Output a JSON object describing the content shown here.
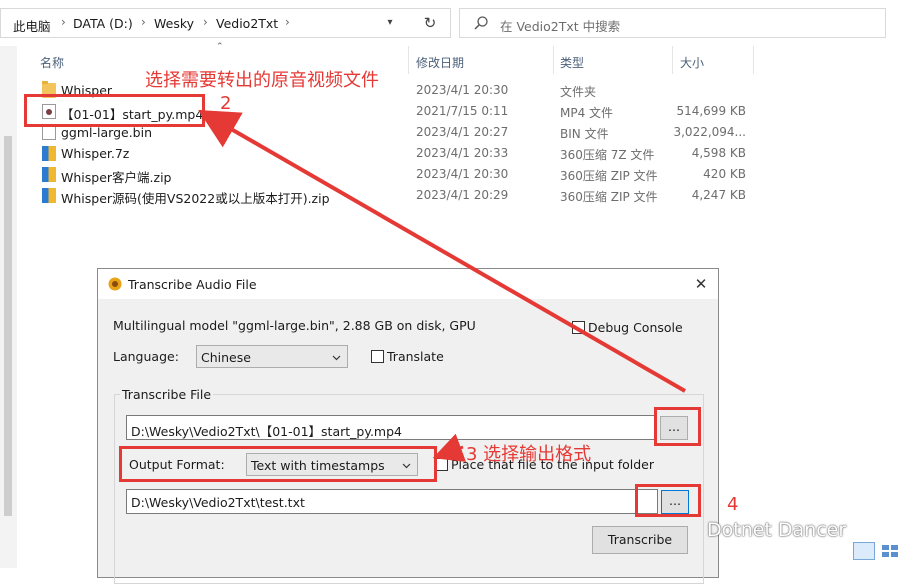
{
  "breadcrumb": [
    "此电脑",
    "DATA (D:)",
    "Wesky",
    "Vedio2Txt"
  ],
  "search": {
    "placeholder": "在 Vedio2Txt 中搜索"
  },
  "columns": {
    "name": "名称",
    "date": "修改日期",
    "type": "类型",
    "size": "大小"
  },
  "files": [
    {
      "name": "Whisper",
      "date": "2023/4/1 20:30",
      "type": "文件夹",
      "size": "",
      "icon": "folder-icon"
    },
    {
      "name": "【01-01】start_py.mp4",
      "date": "2021/7/15 0:11",
      "type": "MP4 文件",
      "size": "514,699 KB",
      "icon": "video-file-icon"
    },
    {
      "name": "ggml-large.bin",
      "date": "2023/4/1 20:27",
      "type": "BIN 文件",
      "size": "3,022,094...",
      "icon": "file-icon"
    },
    {
      "name": "Whisper.7z",
      "date": "2023/4/1 20:33",
      "type": "360压缩 7Z 文件",
      "size": "4,598 KB",
      "icon": "archive-icon"
    },
    {
      "name": "Whisper客户端.zip",
      "date": "2023/4/1 20:30",
      "type": "360压缩 ZIP 文件",
      "size": "420 KB",
      "icon": "archive-icon"
    },
    {
      "name": "Whisper源码(使用VS2022或以上版本打开).zip",
      "date": "2023/4/1 20:29",
      "type": "360压缩 ZIP 文件",
      "size": "4,247 KB",
      "icon": "archive-icon"
    }
  ],
  "annotations": {
    "step1": "选择需要转出的原音视频文件",
    "step2": "2",
    "step3": "3 选择输出格式",
    "step4": "4"
  },
  "dialog": {
    "title": "Transcribe Audio File",
    "model_info": "Multilingual model \"ggml-large.bin\", 2.88 GB on disk, GPU",
    "debug_console": "Debug Console",
    "language_label": "Language:",
    "language_value": "Chinese",
    "translate": "Translate",
    "group_title": "Transcribe File",
    "input_path": "D:\\Wesky\\Vedio2Txt\\【01-01】start_py.mp4",
    "browse": "...",
    "output_format_label": "Output Format:",
    "output_format_value": "Text with timestamps",
    "place_file": "Place that file to the input folder",
    "output_path": "D:\\Wesky\\Vedio2Txt\\test.txt",
    "transcribe": "Transcribe"
  },
  "watermark": "Dotnet Dancer",
  "colors": {
    "annotation": "#e53935",
    "folder": "#f2c55c",
    "dialog_bg": "#f0f0f0"
  }
}
